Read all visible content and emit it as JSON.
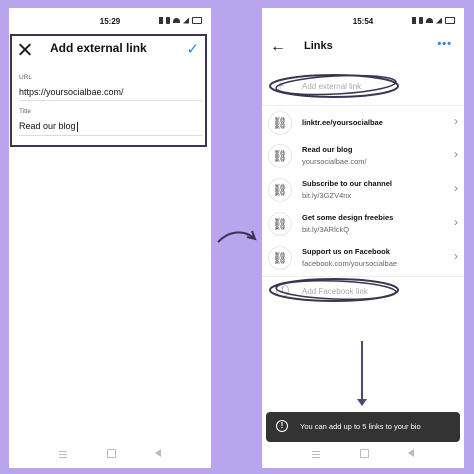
{
  "left_phone": {
    "status_time": "15:29",
    "header": {
      "title": "Add external link"
    },
    "url_field": {
      "label": "URL",
      "value": "https://yoursocialbae.com/"
    },
    "title_field": {
      "label": "Title",
      "value": "Read our blog"
    }
  },
  "right_phone": {
    "status_time": "15:54",
    "header": {
      "title": "Links",
      "more": "•••"
    },
    "add_external_link": "Add external link",
    "links": [
      {
        "title": "linktr.ee/yoursocialbae",
        "subtitle": ""
      },
      {
        "title": "Read our blog",
        "subtitle": "yoursocialbae.com/"
      },
      {
        "title": "Subscribe to our channel",
        "subtitle": "bit.ly/3GZV4nx"
      },
      {
        "title": "Get some design freebies",
        "subtitle": "bit.ly/3ARlckQ"
      },
      {
        "title": "Support us on Facebook",
        "subtitle": "facebook.com/yoursocialbae"
      }
    ],
    "add_facebook_link": "Add Facebook link",
    "toast": "You can add up to 5 links to your bio"
  },
  "colors": {
    "background": "#b9a4ee",
    "accent": "#2a85e8",
    "annotation": "#3a3551"
  }
}
